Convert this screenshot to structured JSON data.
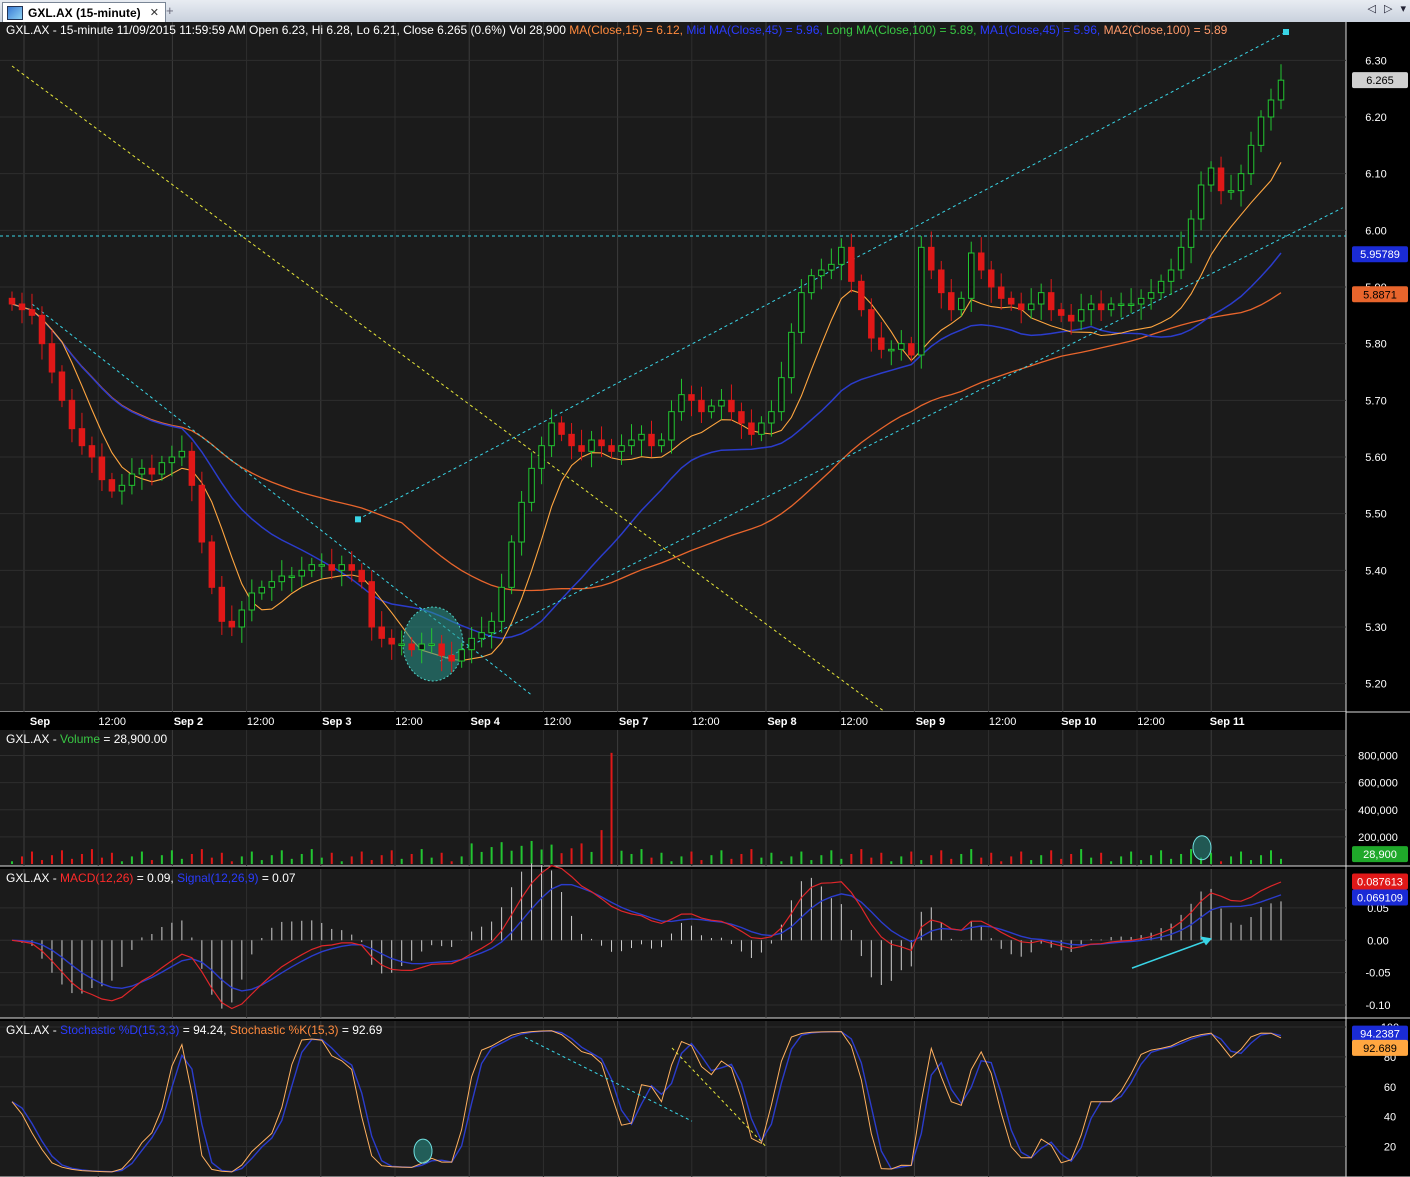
{
  "window": {
    "tab_title": "GXL.AX (15-minute)",
    "close_glyph": "✕",
    "add_tab_glyph": "+",
    "nav_glyphs": [
      "◁",
      "▷",
      "▾"
    ]
  },
  "price_pane": {
    "header": {
      "prefix": "GXL.AX - 15-minute 11/09/2015 11:59:59 AM Open 6.23, Hi 6.28, Lo 6.21, Close 6.265 (0.6%) Vol 28,900",
      "ma": "MA(Close,15) = 6.12,",
      "mid": "Mid MA(Close,45) = 5.96,",
      "long": "Long MA(Close,100) = 5.89,",
      "ma1": "MA1(Close,45) = 5.96,",
      "ma2": "MA2(Close,100) = 5.89"
    },
    "tags": {
      "last": "6.265",
      "mid_ma": "5.95789",
      "long_ma": "5.8871"
    }
  },
  "volume_pane": {
    "header": {
      "prefix": "GXL.AX -",
      "label": "Volume",
      "value": "= 28,900.00"
    },
    "tag": "28,900"
  },
  "macd_pane": {
    "header": {
      "prefix": "GXL.AX -",
      "macd": "MACD(12,26)",
      "macd_val": "= 0.09,",
      "signal": "Signal(12,26,9)",
      "signal_val": "= 0.07"
    },
    "tags": {
      "macd": "0.087613",
      "signal": "0.069109"
    }
  },
  "stoch_pane": {
    "header": {
      "prefix": "GXL.AX -",
      "d": "Stochastic %D(15,3,3)",
      "d_val": "= 94.24,",
      "k": "Stochastic %K(15,3)",
      "k_val": "= 92.69"
    },
    "tags": {
      "d": "94.2387",
      "k": "92.689"
    }
  },
  "colors": {
    "background": "#1b1b1b",
    "up": "#22c531",
    "down": "#e01818",
    "ma15": "#ffa640",
    "ma45": "#2b3ccc",
    "ma100": "#e8652c",
    "trend_cyan": "#39d5e6",
    "trend_yellow": "#e8e83a"
  },
  "chart_data": [
    {
      "type": "candlestick",
      "title": "GXL.AX - 15-minute",
      "x_labels": [
        "Sep",
        "12:00",
        "Sep 2",
        "12:00",
        "Sep 3",
        "12:00",
        "Sep 4",
        "12:00",
        "Sep 7",
        "12:00",
        "Sep 8",
        "12:00",
        "Sep 9",
        "12:00",
        "Sep 10",
        "12:00",
        "Sep 11"
      ],
      "ylim": [
        5.15,
        6.35
      ],
      "y_ticks": [
        5.2,
        5.3,
        5.4,
        5.5,
        5.6,
        5.7,
        5.8,
        5.9,
        6.0,
        6.1,
        6.2,
        6.3
      ],
      "last": {
        "open": 6.23,
        "high": 6.28,
        "low": 6.21,
        "close": 6.265,
        "volume": 28900
      },
      "closes": [
        5.87,
        5.86,
        5.85,
        5.8,
        5.75,
        5.7,
        5.65,
        5.62,
        5.6,
        5.56,
        5.54,
        5.55,
        5.57,
        5.58,
        5.57,
        5.59,
        5.6,
        5.61,
        5.55,
        5.45,
        5.37,
        5.31,
        5.3,
        5.33,
        5.36,
        5.37,
        5.38,
        5.39,
        5.39,
        5.4,
        5.41,
        5.41,
        5.4,
        5.41,
        5.4,
        5.38,
        5.3,
        5.28,
        5.27,
        5.27,
        5.26,
        5.27,
        5.27,
        5.25,
        5.24,
        5.26,
        5.28,
        5.29,
        5.31,
        5.37,
        5.45,
        5.52,
        5.58,
        5.62,
        5.66,
        5.64,
        5.62,
        5.61,
        5.63,
        5.62,
        5.61,
        5.62,
        5.63,
        5.64,
        5.62,
        5.63,
        5.68,
        5.71,
        5.7,
        5.68,
        5.69,
        5.7,
        5.68,
        5.66,
        5.64,
        5.66,
        5.68,
        5.74,
        5.82,
        5.89,
        5.92,
        5.93,
        5.94,
        5.97,
        5.91,
        5.86,
        5.81,
        5.79,
        5.79,
        5.8,
        5.78,
        5.97,
        5.93,
        5.89,
        5.86,
        5.88,
        5.96,
        5.93,
        5.9,
        5.88,
        5.87,
        5.86,
        5.87,
        5.89,
        5.86,
        5.85,
        5.84,
        5.86,
        5.87,
        5.86,
        5.87,
        5.87,
        5.87,
        5.88,
        5.89,
        5.91,
        5.93,
        5.97,
        6.02,
        6.08,
        6.11,
        6.07,
        6.07,
        6.1,
        6.15,
        6.2,
        6.23,
        6.265
      ],
      "series": [
        {
          "name": "MA(Close,15)",
          "last": 6.12
        },
        {
          "name": "Mid MA(Close,45)",
          "last": 5.96
        },
        {
          "name": "Long MA(Close,100)",
          "last": 5.89
        }
      ],
      "horizontal_line": 5.99
    },
    {
      "type": "bar",
      "title": "Volume",
      "ylim": [
        0,
        900000
      ],
      "y_ticks": [
        200000,
        400000,
        600000,
        800000
      ],
      "y_tick_labels": [
        "200,000",
        "400,000",
        "600,000",
        "800,000"
      ],
      "spikes": [
        {
          "index": 59,
          "value": 250000
        },
        {
          "index": 60,
          "value": 820000
        }
      ],
      "last": 28900
    },
    {
      "type": "line",
      "title": "MACD",
      "ylim": [
        -0.12,
        0.11
      ],
      "y_ticks": [
        -0.1,
        -0.05,
        0.0,
        0.05
      ],
      "series": [
        {
          "name": "MACD(12,26)",
          "last": 0.09
        },
        {
          "name": "Signal(12,26,9)",
          "last": 0.07
        }
      ]
    },
    {
      "type": "line",
      "title": "Stochastic",
      "ylim": [
        5,
        100
      ],
      "y_ticks": [
        20,
        40,
        60,
        80,
        100
      ],
      "series": [
        {
          "name": "Stochastic %D(15,3,3)",
          "last": 94.24
        },
        {
          "name": "Stochastic %K(15,3)",
          "last": 92.69
        }
      ]
    }
  ]
}
